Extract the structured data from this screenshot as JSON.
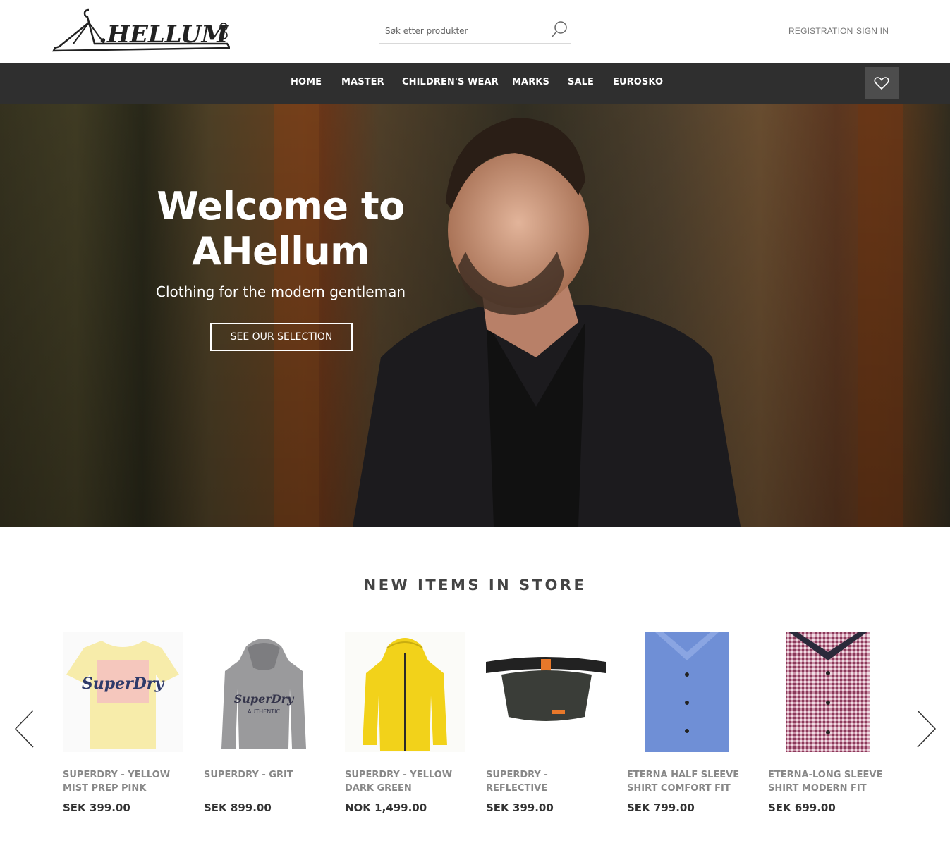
{
  "header": {
    "logo_text": "AHELLUM",
    "search_placeholder": "Søk etter produkter",
    "registration": "REGISTRATION",
    "sign_in": "SIGN IN"
  },
  "nav": {
    "items": [
      "HOME",
      "MASTER",
      "CHILDREN'S WEAR",
      "MARKS",
      "SALE",
      "EUROSKO"
    ]
  },
  "hero": {
    "title_line1": "Welcome to",
    "title_line2": "AHellum",
    "subtitle": "Clothing for the modern gentleman",
    "button": "SEE OUR SELECTION"
  },
  "section": {
    "title": "NEW ITEMS IN STORE"
  },
  "products": [
    {
      "name": "SUPERDRY - YELLOW MIST PREP PINK",
      "price": "SEK 399.00"
    },
    {
      "name": "SUPERDRY - GRIT",
      "price": "SEK 899.00"
    },
    {
      "name": "SUPERDRY - YELLOW DARK GREEN",
      "price": "NOK 1,499.00"
    },
    {
      "name": "SUPERDRY - REFLECTIVE",
      "price": "SEK 399.00"
    },
    {
      "name": "ETERNA HALF SLEEVE SHIRT COMFORT FIT",
      "price": "SEK 799.00"
    },
    {
      "name": "ETERNA-LONG SLEEVE SHIRT MODERN FIT",
      "price": "SEK 699.00"
    }
  ]
}
